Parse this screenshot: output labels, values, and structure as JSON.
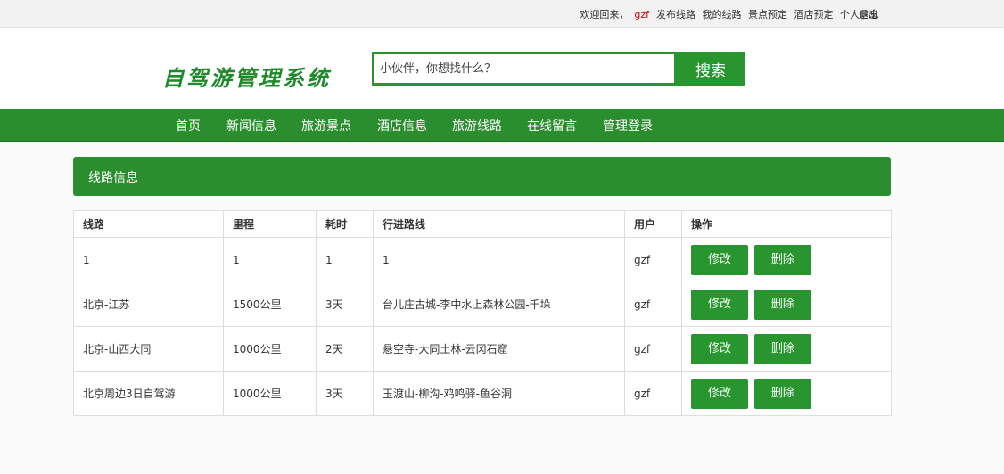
{
  "topbar": {
    "welcome": "欢迎回来，",
    "username": "gzf",
    "links": [
      "发布线路",
      "我的线路",
      "景点预定",
      "酒店预定",
      "个人信息"
    ],
    "logout": "退出"
  },
  "header": {
    "logo": "自驾游管理系统",
    "search_placeholder": "小伙伴，你想找什么？",
    "search_button": "搜索"
  },
  "nav": [
    "首页",
    "新闻信息",
    "旅游景点",
    "酒店信息",
    "旅游线路",
    "在线留言",
    "管理登录"
  ],
  "panel": {
    "title": "线路信息"
  },
  "table": {
    "headers": [
      "线路",
      "里程",
      "耗时",
      "行进路线",
      "用户",
      "操作"
    ],
    "edit_label": "修改",
    "delete_label": "删除",
    "rows": [
      {
        "route": "1",
        "distance": "1",
        "duration": "1",
        "path": "1",
        "user": "gzf"
      },
      {
        "route": "北京-江苏",
        "distance": "1500公里",
        "duration": "3天",
        "path": "台儿庄古城-李中水上森林公园-千垛",
        "user": "gzf"
      },
      {
        "route": "北京-山西大同",
        "distance": "1000公里",
        "duration": "2天",
        "path": "悬空寺-大同土林-云冈石窟",
        "user": "gzf"
      },
      {
        "route": "北京周边3日自驾游",
        "distance": "1000公里",
        "duration": "3天",
        "path": "玉渡山-柳沟-鸡鸣驿-鱼谷洞",
        "user": "gzf"
      }
    ]
  },
  "colors": {
    "brand_green": "#2a8e2f",
    "username_red": "#cc0000"
  }
}
